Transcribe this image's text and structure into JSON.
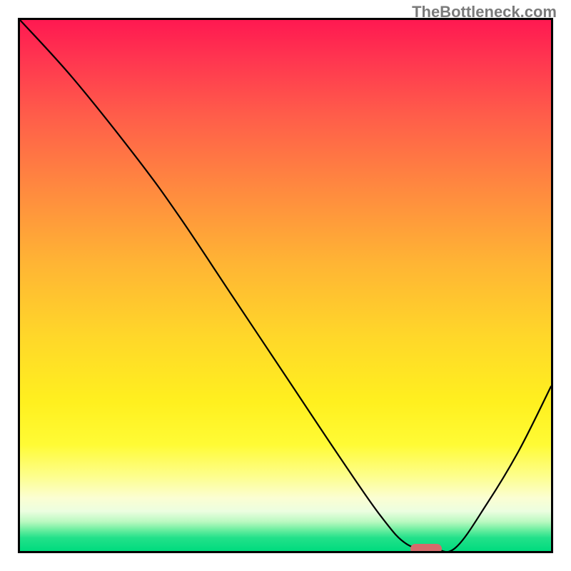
{
  "watermark": "TheBottleneck.com",
  "chart_data": {
    "type": "line",
    "title": "",
    "xlabel": "",
    "ylabel": "",
    "xlim": [
      0,
      100
    ],
    "ylim": [
      0,
      100
    ],
    "grid": false,
    "legend": null,
    "series": [
      {
        "name": "curve",
        "x": [
          0,
          10,
          22,
          30,
          40,
          50,
          60,
          68,
          73,
          78,
          82,
          88,
          94,
          100
        ],
        "y": [
          100,
          89,
          74,
          63,
          48,
          33,
          18,
          6.5,
          1.2,
          0.4,
          0.6,
          9,
          19,
          31
        ]
      }
    ],
    "marker": {
      "name": "target-range",
      "x_center": 76.5,
      "width_pct": 6,
      "y": 0.4,
      "color": "#d66b6b"
    },
    "gradient_stops": [
      {
        "pct": 0,
        "color": "#ff1951"
      },
      {
        "pct": 50,
        "color": "#ffb534"
      },
      {
        "pct": 80,
        "color": "#fffb35"
      },
      {
        "pct": 95,
        "color": "#b9f9c0"
      },
      {
        "pct": 100,
        "color": "#00db7e"
      }
    ]
  }
}
